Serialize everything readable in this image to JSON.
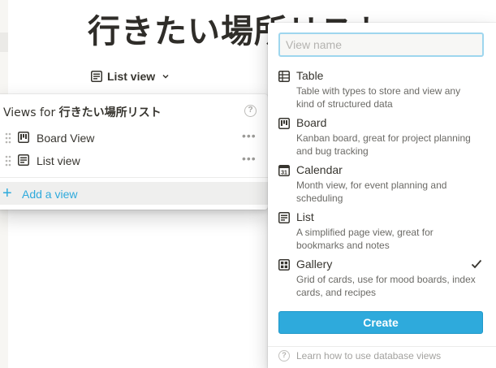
{
  "page": {
    "title": "行きたい場所リスト",
    "current_view_label": "List view"
  },
  "views_panel": {
    "header_prefix": "Views for ",
    "header_db_name": "行きたい場所リスト",
    "help_glyph": "?",
    "views": [
      {
        "label": "Board View",
        "icon": "board-icon",
        "more": "•••"
      },
      {
        "label": "List view",
        "icon": "list-icon",
        "more": "•••"
      }
    ],
    "add_view_label": "Add a view",
    "add_glyph": "+"
  },
  "create_menu": {
    "name_placeholder": "View name",
    "options": [
      {
        "name": "Table",
        "icon": "table-icon",
        "description": "Table with types to store and view any kind of structured data",
        "selected": false
      },
      {
        "name": "Board",
        "icon": "board-icon",
        "description": "Kanban board, great for project planning and bug tracking",
        "selected": false
      },
      {
        "name": "Calendar",
        "icon": "calendar-icon",
        "icon_text": "31",
        "description": "Month view, for event planning and scheduling",
        "selected": false
      },
      {
        "name": "List",
        "icon": "list-icon",
        "description": "A simplified page view, great for bookmarks and notes",
        "selected": false
      },
      {
        "name": "Gallery",
        "icon": "gallery-icon",
        "description": "Grid of cards, use for mood boards, index cards, and recipes",
        "selected": true
      }
    ],
    "create_label": "Create",
    "help_glyph": "?",
    "learn_label": "Learn how to use database views"
  },
  "colors": {
    "accent": "#2eaadc",
    "text": "#37352f",
    "muted": "#6b6a66"
  }
}
